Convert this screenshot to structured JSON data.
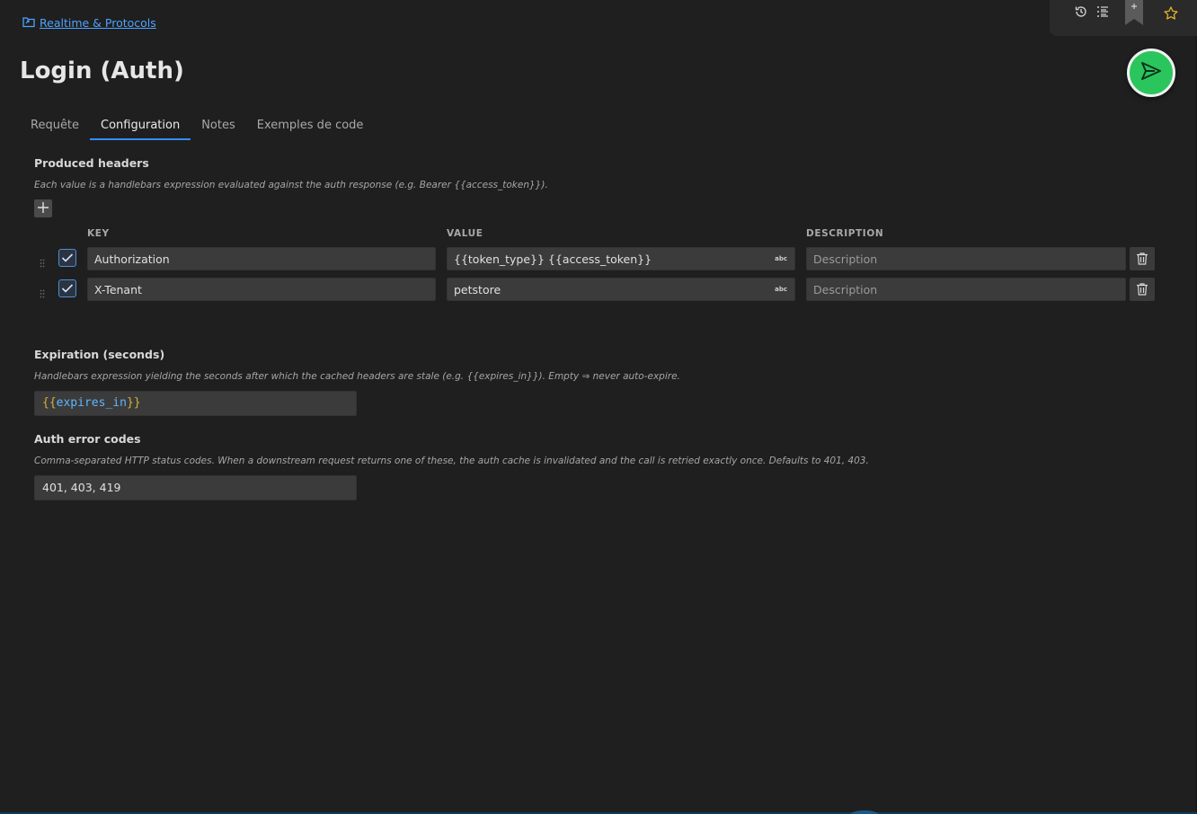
{
  "breadcrumb": {
    "label": "Realtime & Protocols",
    "icon": "folder-link-icon"
  },
  "page": {
    "title": "Login (Auth)"
  },
  "toolbar": {
    "icons": [
      "history-icon",
      "list-icon",
      "bookmark-add-icon",
      "star-icon"
    ]
  },
  "tabs": [
    {
      "label": "Requête",
      "active": false
    },
    {
      "label": "Configuration",
      "active": true
    },
    {
      "label": "Notes",
      "active": false
    },
    {
      "label": "Exemples de code",
      "active": false
    }
  ],
  "produced_headers": {
    "title": "Produced headers",
    "description": "Each value is a handlebars expression evaluated against the auth response (e.g. Bearer {{access_token}}).",
    "columns": {
      "key": "KEY",
      "value": "VALUE",
      "description": "DESCRIPTION"
    },
    "value_type_badge": "abc",
    "rows": [
      {
        "checked": true,
        "key": "Authorization",
        "value": "{{token_type}} {{access_token}}",
        "description_placeholder": "Description"
      },
      {
        "checked": true,
        "key": "X-Tenant",
        "value": "petstore",
        "description_placeholder": "Description"
      }
    ]
  },
  "expiration": {
    "title": "Expiration (seconds)",
    "description": "Handlebars expression yielding the seconds after which the cached headers are stale (e.g. {{expires_in}}). Empty ⇒ never auto-expire.",
    "value_open": "{{",
    "value_var": "expires_in",
    "value_close": "}}"
  },
  "auth_error_codes": {
    "title": "Auth error codes",
    "description": "Comma-separated HTTP status codes. When a downstream request returns one of these, the auth cache is invalidated and the call is retried exactly once. Defaults to 401, 403.",
    "value": "401, 403, 419"
  },
  "colors": {
    "accent": "#2f8fff",
    "send": "#2bc55e",
    "link": "#4ea3ff",
    "background": "#1f1f1f"
  }
}
